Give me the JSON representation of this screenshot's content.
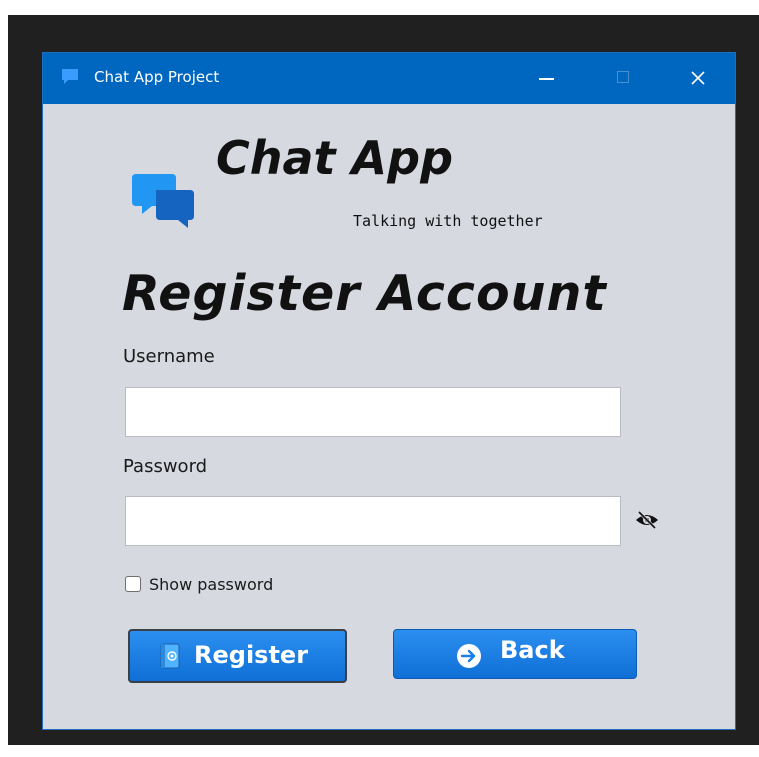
{
  "window": {
    "title": "Chat App Project",
    "icon": "chat-bubble-icon",
    "controls": [
      "minimize-icon",
      "maximize-icon",
      "close-icon"
    ]
  },
  "branding": {
    "app_name": "Chat App",
    "tagline": "Talking with together",
    "logo": "chat-bubbles-icon"
  },
  "form": {
    "heading": "Register Account",
    "username_label": "Username",
    "username_value": "",
    "password_label": "Password",
    "password_value": "",
    "show_password_label": "Show password",
    "show_password_checked": false,
    "toggle_visibility_icon": "eye-slash-icon"
  },
  "buttons": {
    "register_label": "Register",
    "register_icon": "contact-card-icon",
    "back_label": "Back",
    "back_icon": "arrow-right-icon"
  },
  "colors": {
    "titlebar": "#0067c0",
    "window_bg": "#d6d9e0",
    "button": "#1a7fe6",
    "backdrop": "#202020"
  }
}
